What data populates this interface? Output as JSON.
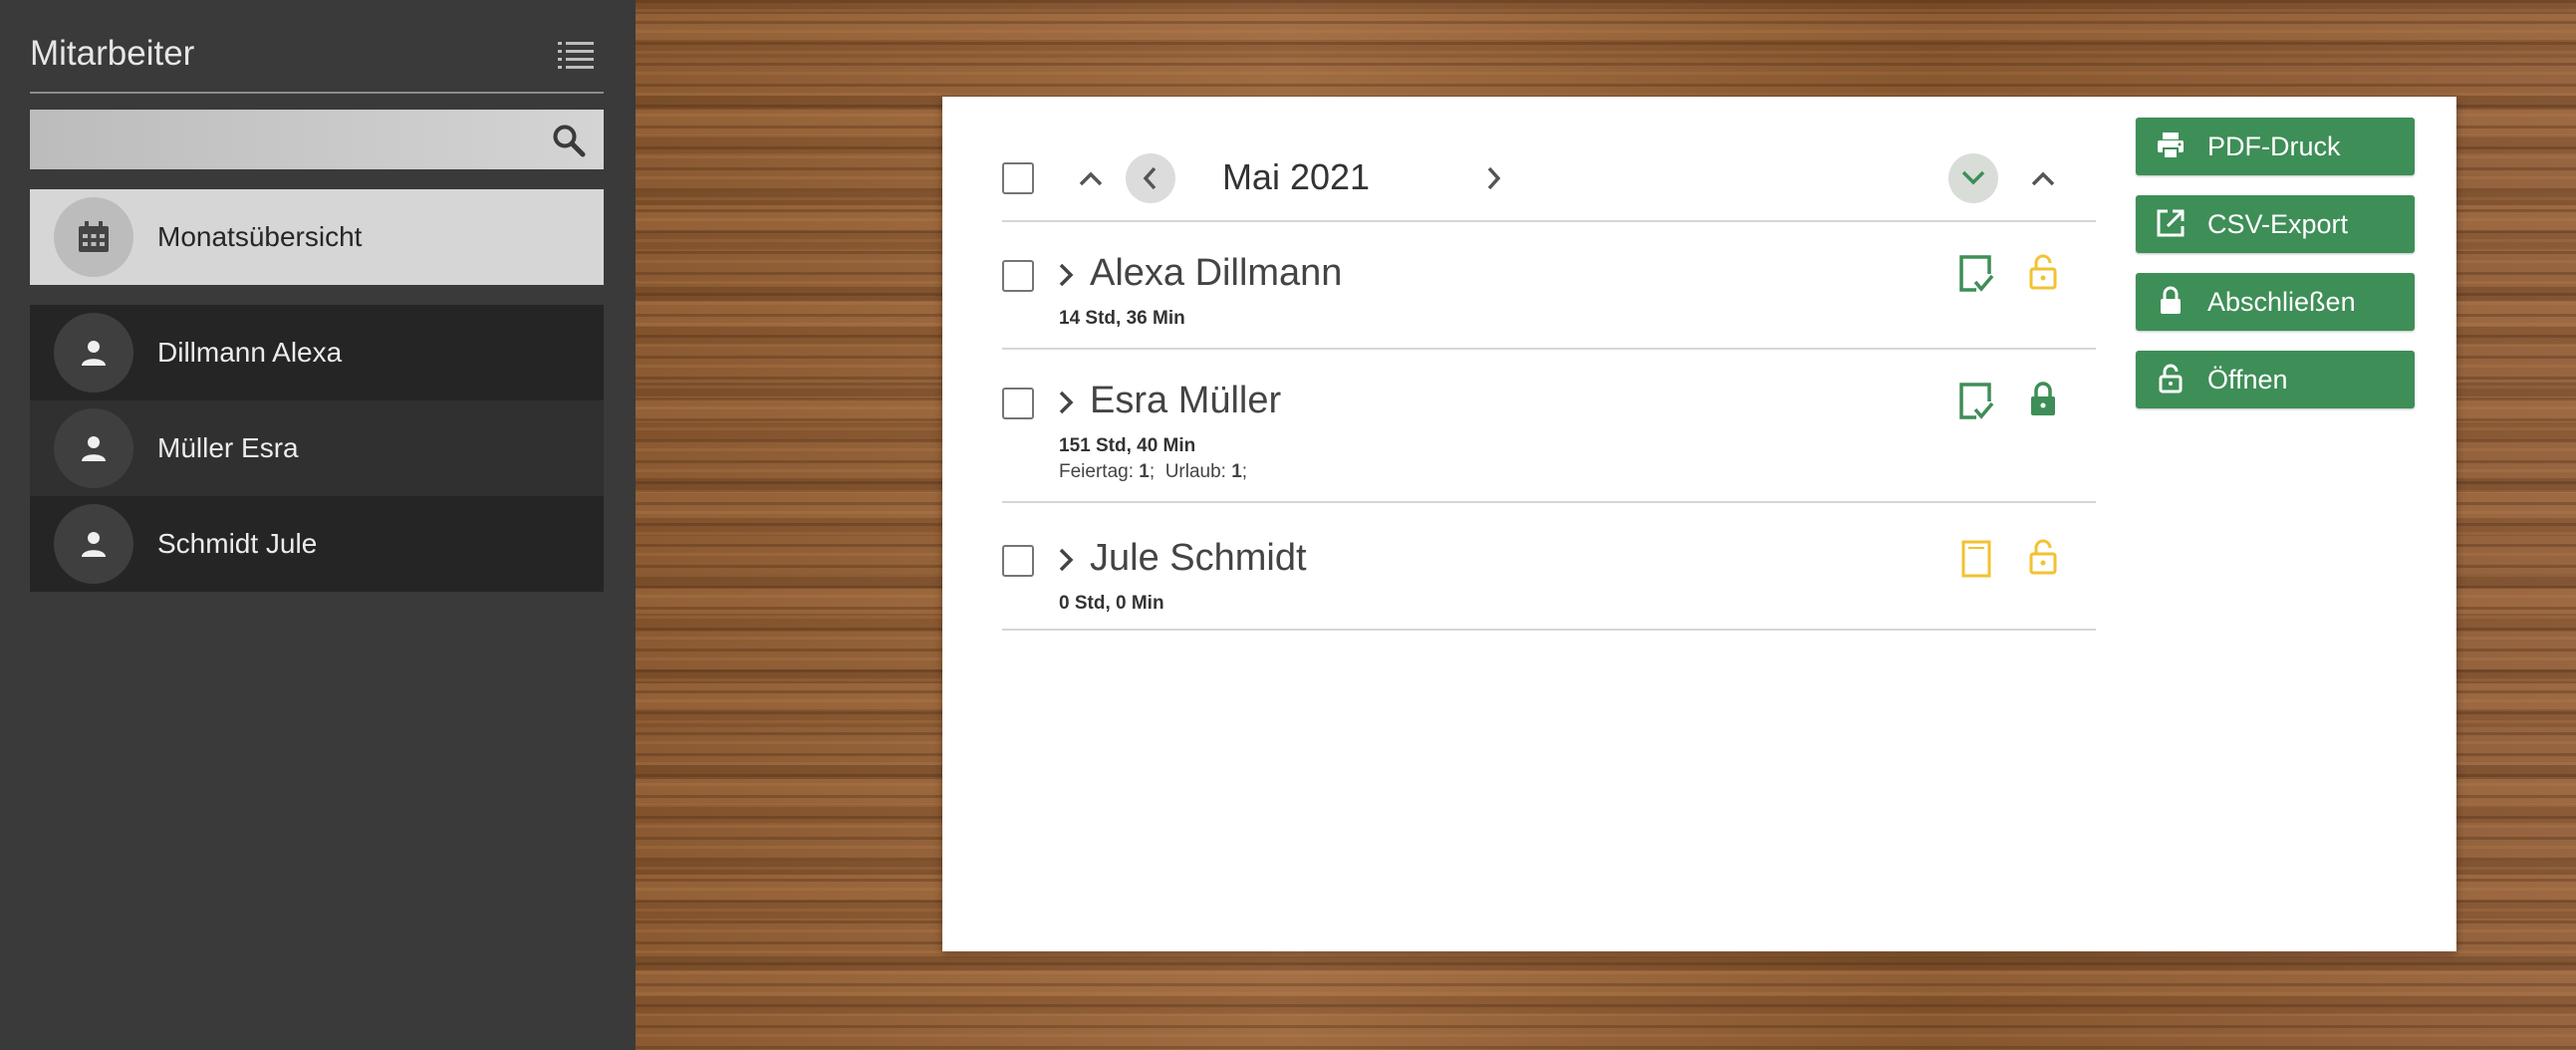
{
  "sidebar": {
    "title": "Mitarbeiter",
    "search": {
      "placeholder": "",
      "value": ""
    },
    "overview_label": "Monatsübersicht",
    "employees": [
      {
        "label": "Dillmann Alexa"
      },
      {
        "label": "Müller Esra"
      },
      {
        "label": "Schmidt Jule"
      }
    ]
  },
  "main": {
    "month": "Mai 2021",
    "rows": [
      {
        "name": "Alexa Dillmann",
        "hours": "14 Std,  36 Min",
        "extra": null,
        "doc_status": "approved",
        "lock_status": "unlocked"
      },
      {
        "name": "Esra Müller",
        "hours": "151 Std,  40 Min",
        "extra": {
          "feiertag_label": "Feiertag:",
          "feiertag_value": "1",
          "urlaub_label": "Urlaub:",
          "urlaub_value": "1"
        },
        "doc_status": "approved",
        "lock_status": "locked"
      },
      {
        "name": "Jule Schmidt",
        "hours": "0 Std,  0 Min",
        "extra": null,
        "doc_status": "open",
        "lock_status": "unlocked"
      }
    ]
  },
  "actions": {
    "pdf": "PDF-Druck",
    "csv": "CSV-Export",
    "close": "Abschließen",
    "open": "Öffnen"
  },
  "colors": {
    "accent_green": "#3e8e57",
    "warning_yellow": "#f2c230",
    "sidebar_bg": "#3a3a3a"
  }
}
